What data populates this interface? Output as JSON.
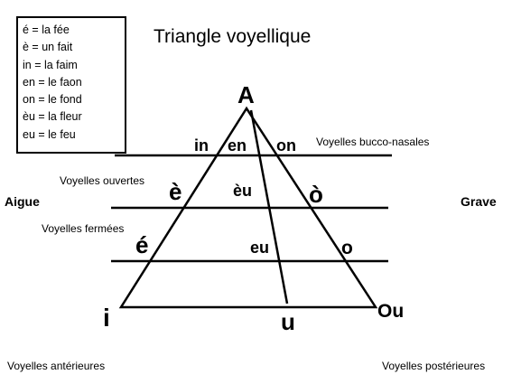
{
  "title": "Triangle voyellique",
  "legend": [
    "é = la fée",
    "è = un fait",
    "in = la faim",
    "en = le faon",
    "on = le fond",
    "èu = la fleur",
    "eu = le feu"
  ],
  "vertices": {
    "top": "A",
    "left": "i",
    "middle": "u",
    "right": "Ou"
  },
  "row_nasal": {
    "left": "in",
    "mid": "en",
    "right": "on"
  },
  "row_open": {
    "left": "è",
    "mid": "èu",
    "right": "ò"
  },
  "row_closed": {
    "left": "é",
    "mid": "eu",
    "right": "o"
  },
  "labels": {
    "bucco_nasal": "Voyelles bucco-nasales",
    "open": "Voyelles ouvertes",
    "closed": "Voyelles fermées",
    "aigue": "Aigue",
    "grave": "Grave",
    "anterior": "Voyelles antérieures",
    "posterior": "Voyelles postérieures"
  }
}
